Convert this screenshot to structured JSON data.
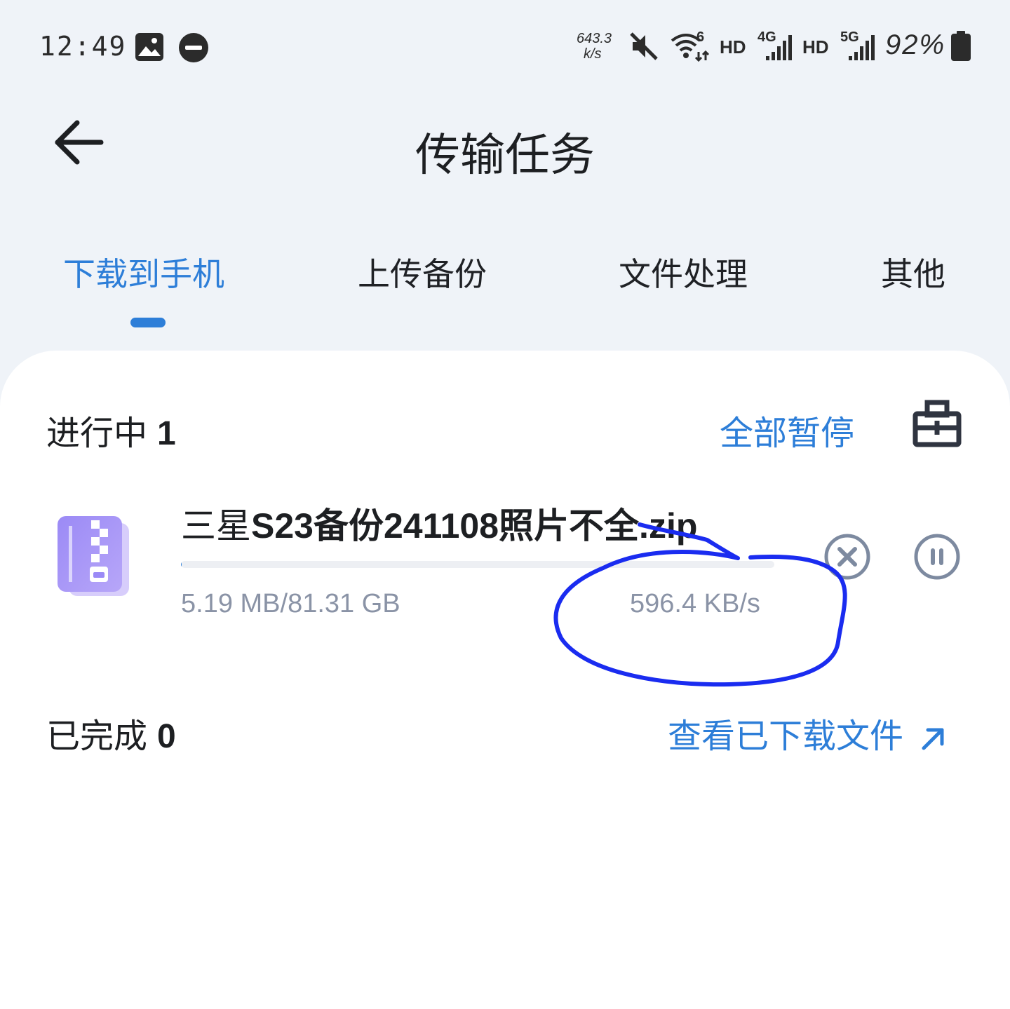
{
  "status_bar": {
    "time": "12:49",
    "net_speed_value": "643.3",
    "net_speed_unit": "k/s",
    "wifi_generation": "6",
    "hd_label_1": "HD",
    "hd_label_2": "HD",
    "sim1_network": "4G",
    "sim2_network": "5G",
    "battery": "92%",
    "icons": [
      "gallery-icon",
      "do-not-disturb-icon",
      "mute-icon",
      "wifi-icon",
      "signal-icon",
      "battery-icon"
    ]
  },
  "header": {
    "title": "传输任务"
  },
  "tabs": [
    {
      "label": "下载到手机",
      "active": true
    },
    {
      "label": "上传备份",
      "active": false
    },
    {
      "label": "文件处理",
      "active": false
    },
    {
      "label": "其他",
      "active": false
    }
  ],
  "in_progress": {
    "title": "进行中",
    "count": "1",
    "pause_all_label": "全部暂停",
    "tools_icon": "toolbox-icon"
  },
  "task": {
    "file_name_prefix": "三星",
    "file_name_rest": "S23备份241108照片不全.zip",
    "size_progress": "5.19 MB/81.31 GB",
    "speed": "596.4 KB/s",
    "progress_fraction": 0.0001,
    "file_type_icon": "zip-file-icon"
  },
  "completed": {
    "title": "已完成",
    "count": "0",
    "view_downloads_label": "查看已下载文件"
  },
  "colors": {
    "accent": "#2d7ed8",
    "background": "#eff3f8",
    "card": "#ffffff",
    "secondary_text": "#8a93a6",
    "annotation": "#1a2cf0"
  }
}
